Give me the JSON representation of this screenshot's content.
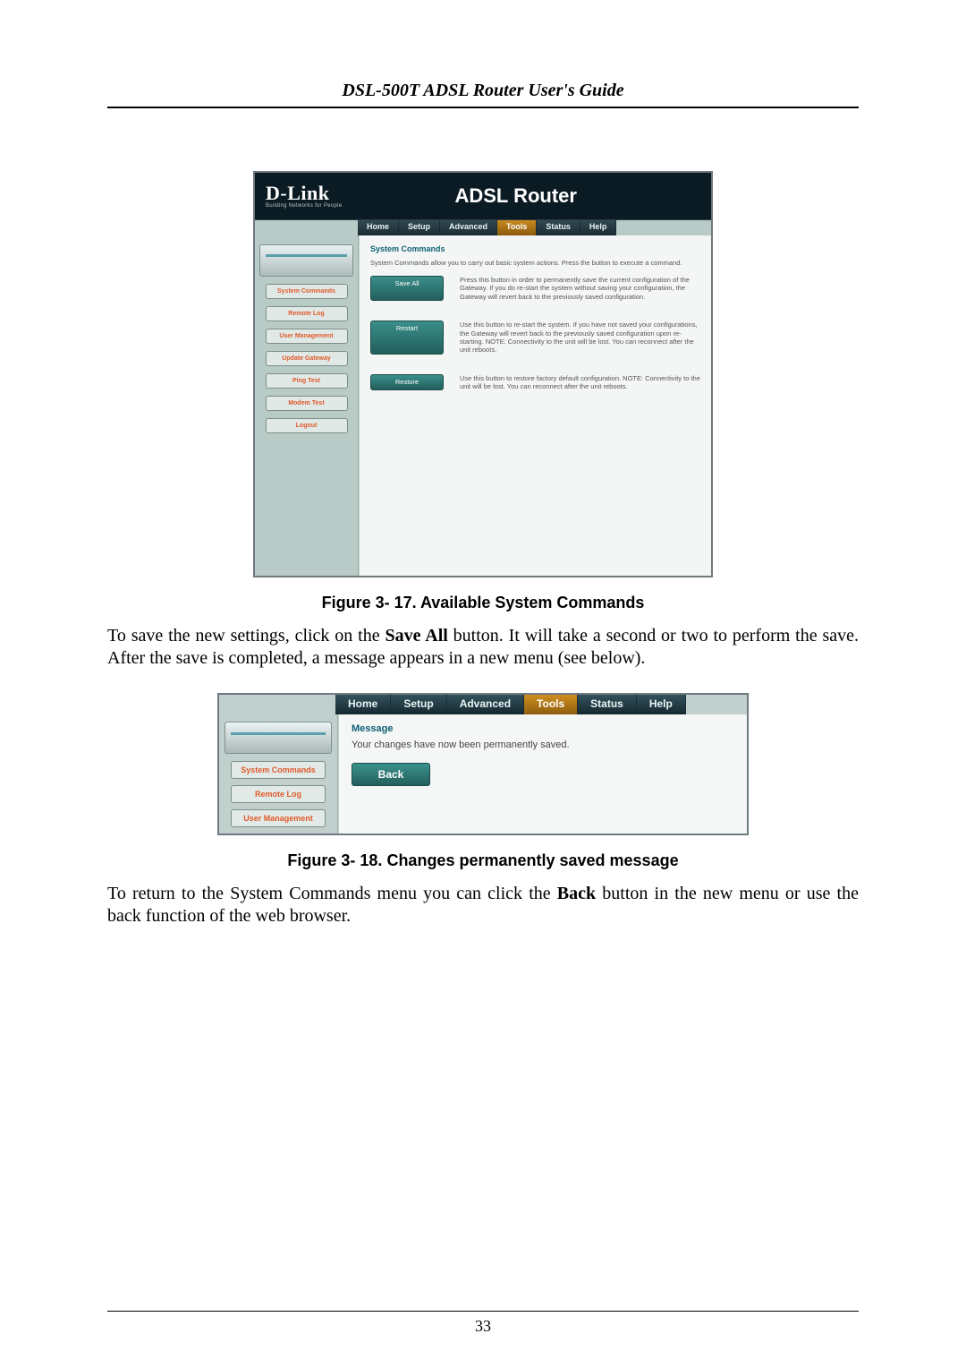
{
  "doc": {
    "running_head": "DSL-500T ADSL Router User's Guide",
    "page_number": "33"
  },
  "fig1": {
    "brand": "D-Link",
    "brand_tag": "Building Networks for People",
    "title": "ADSL Router",
    "tabs": [
      "Home",
      "Setup",
      "Advanced",
      "Tools",
      "Status",
      "Help"
    ],
    "active_tab_index": 3,
    "sidebar": [
      "System Commands",
      "Remote Log",
      "User Management",
      "Update Gateway",
      "Ping Test",
      "Modem Test",
      "Logout"
    ],
    "section_title": "System Commands",
    "section_intro": "System Commands allow you to carry out basic system actions. Press the button to execute a command.",
    "commands": [
      {
        "label": "Save All",
        "desc": "Press this button in order to permanently save the current configuration of the Gateway. If you do re-start the system without saving your configuration, the Gateway will revert back to the previously saved configuration."
      },
      {
        "label": "Restart",
        "desc": "Use this button to re-start the system. If you have not saved your configurations, the Gateway will revert back to the previously saved configuration upon re-starting. NOTE: Connectivity to the unit will be lost. You can reconnect after the unit reboots."
      },
      {
        "label": "Restore",
        "desc": "Use this button to restore factory default configuration. NOTE: Connectivity to the unit will be lost. You can reconnect after the unit reboots."
      }
    ],
    "caption": "Figure 3- 17. Available System Commands"
  },
  "para1": {
    "pre": "To save the new settings, click on the ",
    "bold": "Save All",
    "post": " button. It will take a second or two to perform the save. After the save is completed, a message appears in a new menu (see below)."
  },
  "fig2": {
    "tabs": [
      "Home",
      "Setup",
      "Advanced",
      "Tools",
      "Status",
      "Help"
    ],
    "active_tab_index": 3,
    "sidebar": [
      "System Commands",
      "Remote Log",
      "User Management"
    ],
    "msg_title": "Message",
    "msg_text": "Your changes have now been permanently saved.",
    "back_label": "Back",
    "caption": "Figure 3- 18. Changes permanently saved message"
  },
  "para2": {
    "pre": "To return to the System Commands menu you can click the ",
    "bold": "Back",
    "post": " button in the new menu or use the back function of the web browser."
  }
}
